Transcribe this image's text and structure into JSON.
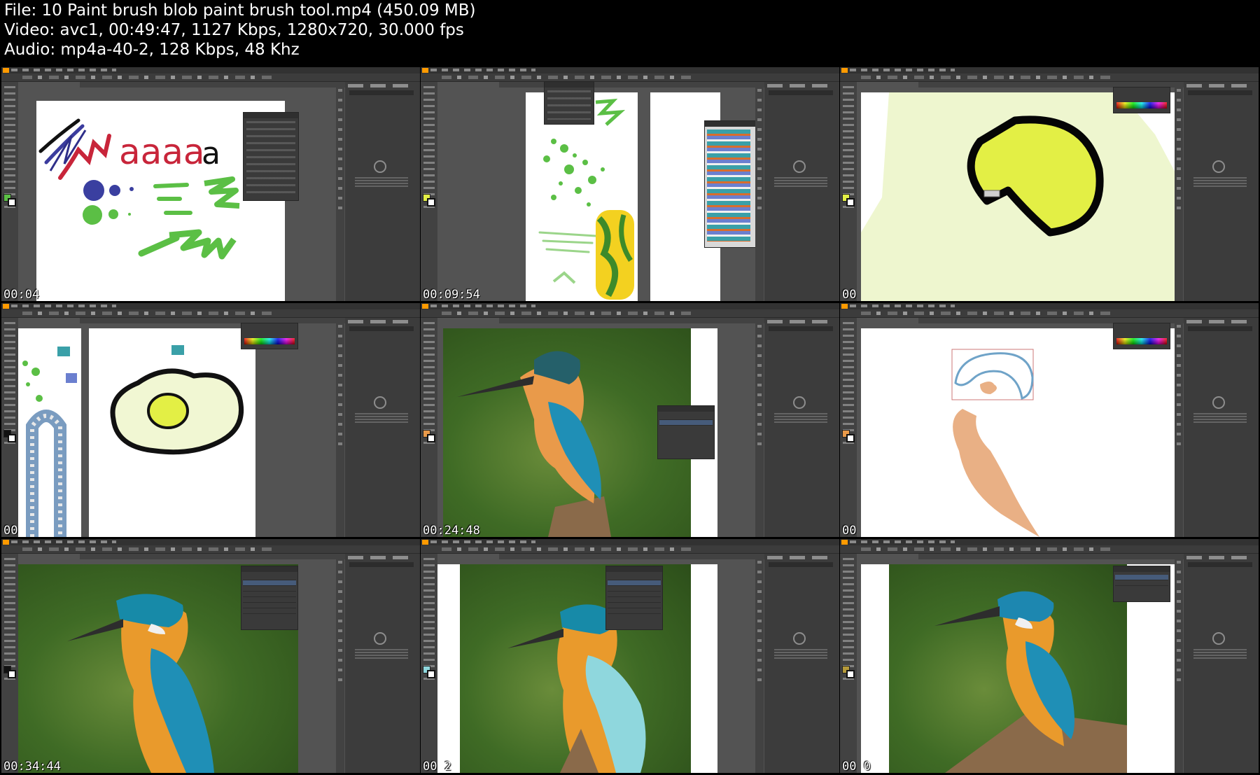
{
  "header": {
    "file_line": "File: 10  Paint brush   blob paint brush tool.mp4 (450.09 MB)",
    "video_line": "Video: avc1, 00:49:47, 1127 Kbps, 1280x720, 30.000 fps",
    "audio_line": "Audio: mp4a-40-2, 128 Kbps, 48 Khz"
  },
  "thumbnails": [
    {
      "timestamp": "00:04",
      "scene": "brush strokes and letters"
    },
    {
      "timestamp": "00:09:54",
      "scene": "brush libraries"
    },
    {
      "timestamp": "00",
      "scene": "yellow blob shape"
    },
    {
      "timestamp": "00",
      "scene": "egg drawing"
    },
    {
      "timestamp": "00:24:48",
      "scene": "kingfisher tracing"
    },
    {
      "timestamp": "00",
      "scene": "blob outlines"
    },
    {
      "timestamp": "00:34:44",
      "scene": "kingfisher photo"
    },
    {
      "timestamp": "00    2",
      "scene": "kingfisher painted wing"
    },
    {
      "timestamp": "00    0",
      "scene": "kingfisher final"
    }
  ],
  "colors": {
    "ui_dark": "#535353",
    "app_accent": "#ff9a00",
    "blob_yellow": "#e3ef45",
    "brush_green": "#5bbf45",
    "letter_red": "#c8253a",
    "skin_tone": "#e9b085"
  }
}
